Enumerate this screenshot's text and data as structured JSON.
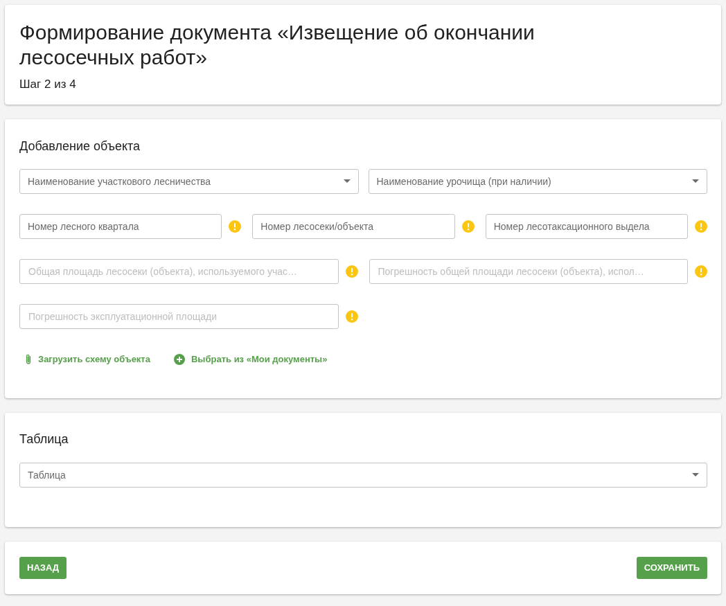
{
  "header": {
    "title": "Формирование документа «Извещение об окончании лесосечных работ»",
    "step": "Шаг 2 из 4"
  },
  "object_section": {
    "title": "Добавление объекта",
    "rows": [
      [
        {
          "kind": "select",
          "label": "Наименование участкового лесничества",
          "warning": false
        },
        {
          "kind": "select",
          "label": "Наименование урочища (при наличии)",
          "warning": false
        }
      ],
      [
        {
          "kind": "text",
          "label": "Номер лесного квартала",
          "warning": true
        },
        {
          "kind": "text",
          "label": "Номер лесосеки/объекта",
          "warning": true
        },
        {
          "kind": "text",
          "label": "Номер лесотаксационного выдела",
          "warning": true
        }
      ],
      [
        {
          "kind": "text",
          "placeholder": "Общая площадь лесосеки (объекта), используемого учас…",
          "warning": true
        },
        {
          "kind": "text",
          "placeholder": "Погрешность общей площади лесосеки (объекта), испол…",
          "warning": true
        }
      ],
      [
        {
          "kind": "text",
          "placeholder": "Погрешность эксплуатационной площади",
          "warning": true
        }
      ]
    ],
    "links": [
      {
        "kind": "attach",
        "label": "Загрузить схему объекта"
      },
      {
        "kind": "add",
        "label": "Выбрать из «Мои документы»"
      }
    ]
  },
  "table_section": {
    "title": "Таблица",
    "select": {
      "label": "Таблица"
    }
  },
  "footer": {
    "back": "НАЗАД",
    "save": "СОХРАНИТЬ"
  }
}
